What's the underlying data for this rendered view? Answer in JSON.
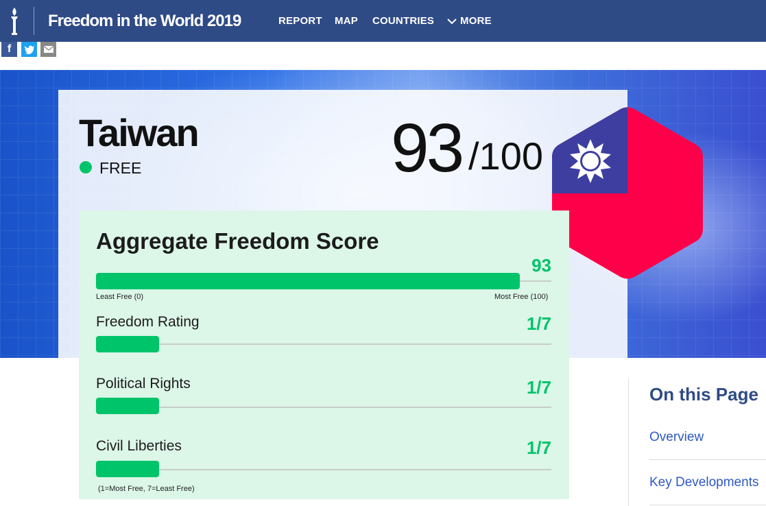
{
  "header": {
    "site_title": "Freedom in the World 2019",
    "nav": {
      "report": "REPORT",
      "map": "MAP",
      "countries": "COUNTRIES",
      "more": "MORE"
    }
  },
  "share": {
    "facebook": "f"
  },
  "country": {
    "name": "Taiwan",
    "status": "FREE",
    "status_color": "#00c46a",
    "score": "93",
    "score_total": "/100",
    "flag_icon": "taiwan-flag-hexagon"
  },
  "aggregate": {
    "title": "Aggregate Freedom Score",
    "value": "93",
    "value_fraction": 0.93,
    "min_label": "Least Free (0)",
    "max_label": "Most Free (100)"
  },
  "ratings": [
    {
      "label": "Freedom Rating",
      "value": "1/7"
    },
    {
      "label": "Political Rights",
      "value": "1/7"
    },
    {
      "label": "Civil Liberties",
      "value": "1/7"
    }
  ],
  "ratings_note": "(1=Most Free, 7=Least Free)",
  "sidebar": {
    "title": "On this Page",
    "links": [
      "Overview",
      "Key Developments"
    ]
  },
  "colors": {
    "brand_navy": "#2f4b86",
    "accent_green": "#00c46a",
    "flag_red": "#fe0049",
    "flag_blue": "#3d3ea0"
  }
}
